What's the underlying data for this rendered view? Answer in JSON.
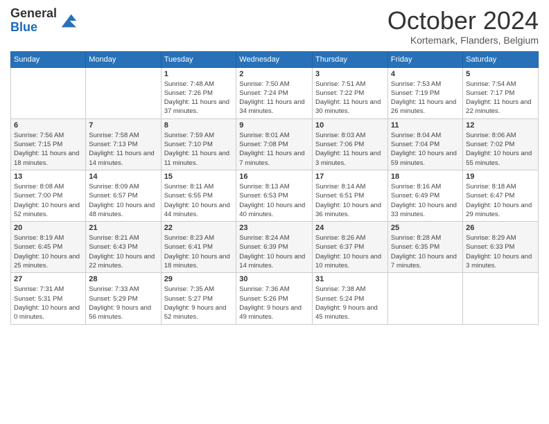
{
  "header": {
    "logo_line1": "General",
    "logo_line2": "Blue",
    "month": "October 2024",
    "location": "Kortemark, Flanders, Belgium"
  },
  "weekdays": [
    "Sunday",
    "Monday",
    "Tuesday",
    "Wednesday",
    "Thursday",
    "Friday",
    "Saturday"
  ],
  "weeks": [
    [
      {
        "day": "",
        "info": ""
      },
      {
        "day": "",
        "info": ""
      },
      {
        "day": "1",
        "info": "Sunrise: 7:48 AM\nSunset: 7:26 PM\nDaylight: 11 hours and 37 minutes."
      },
      {
        "day": "2",
        "info": "Sunrise: 7:50 AM\nSunset: 7:24 PM\nDaylight: 11 hours and 34 minutes."
      },
      {
        "day": "3",
        "info": "Sunrise: 7:51 AM\nSunset: 7:22 PM\nDaylight: 11 hours and 30 minutes."
      },
      {
        "day": "4",
        "info": "Sunrise: 7:53 AM\nSunset: 7:19 PM\nDaylight: 11 hours and 26 minutes."
      },
      {
        "day": "5",
        "info": "Sunrise: 7:54 AM\nSunset: 7:17 PM\nDaylight: 11 hours and 22 minutes."
      }
    ],
    [
      {
        "day": "6",
        "info": "Sunrise: 7:56 AM\nSunset: 7:15 PM\nDaylight: 11 hours and 18 minutes."
      },
      {
        "day": "7",
        "info": "Sunrise: 7:58 AM\nSunset: 7:13 PM\nDaylight: 11 hours and 14 minutes."
      },
      {
        "day": "8",
        "info": "Sunrise: 7:59 AM\nSunset: 7:10 PM\nDaylight: 11 hours and 11 minutes."
      },
      {
        "day": "9",
        "info": "Sunrise: 8:01 AM\nSunset: 7:08 PM\nDaylight: 11 hours and 7 minutes."
      },
      {
        "day": "10",
        "info": "Sunrise: 8:03 AM\nSunset: 7:06 PM\nDaylight: 11 hours and 3 minutes."
      },
      {
        "day": "11",
        "info": "Sunrise: 8:04 AM\nSunset: 7:04 PM\nDaylight: 10 hours and 59 minutes."
      },
      {
        "day": "12",
        "info": "Sunrise: 8:06 AM\nSunset: 7:02 PM\nDaylight: 10 hours and 55 minutes."
      }
    ],
    [
      {
        "day": "13",
        "info": "Sunrise: 8:08 AM\nSunset: 7:00 PM\nDaylight: 10 hours and 52 minutes."
      },
      {
        "day": "14",
        "info": "Sunrise: 8:09 AM\nSunset: 6:57 PM\nDaylight: 10 hours and 48 minutes."
      },
      {
        "day": "15",
        "info": "Sunrise: 8:11 AM\nSunset: 6:55 PM\nDaylight: 10 hours and 44 minutes."
      },
      {
        "day": "16",
        "info": "Sunrise: 8:13 AM\nSunset: 6:53 PM\nDaylight: 10 hours and 40 minutes."
      },
      {
        "day": "17",
        "info": "Sunrise: 8:14 AM\nSunset: 6:51 PM\nDaylight: 10 hours and 36 minutes."
      },
      {
        "day": "18",
        "info": "Sunrise: 8:16 AM\nSunset: 6:49 PM\nDaylight: 10 hours and 33 minutes."
      },
      {
        "day": "19",
        "info": "Sunrise: 8:18 AM\nSunset: 6:47 PM\nDaylight: 10 hours and 29 minutes."
      }
    ],
    [
      {
        "day": "20",
        "info": "Sunrise: 8:19 AM\nSunset: 6:45 PM\nDaylight: 10 hours and 25 minutes."
      },
      {
        "day": "21",
        "info": "Sunrise: 8:21 AM\nSunset: 6:43 PM\nDaylight: 10 hours and 22 minutes."
      },
      {
        "day": "22",
        "info": "Sunrise: 8:23 AM\nSunset: 6:41 PM\nDaylight: 10 hours and 18 minutes."
      },
      {
        "day": "23",
        "info": "Sunrise: 8:24 AM\nSunset: 6:39 PM\nDaylight: 10 hours and 14 minutes."
      },
      {
        "day": "24",
        "info": "Sunrise: 8:26 AM\nSunset: 6:37 PM\nDaylight: 10 hours and 10 minutes."
      },
      {
        "day": "25",
        "info": "Sunrise: 8:28 AM\nSunset: 6:35 PM\nDaylight: 10 hours and 7 minutes."
      },
      {
        "day": "26",
        "info": "Sunrise: 8:29 AM\nSunset: 6:33 PM\nDaylight: 10 hours and 3 minutes."
      }
    ],
    [
      {
        "day": "27",
        "info": "Sunrise: 7:31 AM\nSunset: 5:31 PM\nDaylight: 10 hours and 0 minutes."
      },
      {
        "day": "28",
        "info": "Sunrise: 7:33 AM\nSunset: 5:29 PM\nDaylight: 9 hours and 56 minutes."
      },
      {
        "day": "29",
        "info": "Sunrise: 7:35 AM\nSunset: 5:27 PM\nDaylight: 9 hours and 52 minutes."
      },
      {
        "day": "30",
        "info": "Sunrise: 7:36 AM\nSunset: 5:26 PM\nDaylight: 9 hours and 49 minutes."
      },
      {
        "day": "31",
        "info": "Sunrise: 7:38 AM\nSunset: 5:24 PM\nDaylight: 9 hours and 45 minutes."
      },
      {
        "day": "",
        "info": ""
      },
      {
        "day": "",
        "info": ""
      }
    ]
  ]
}
